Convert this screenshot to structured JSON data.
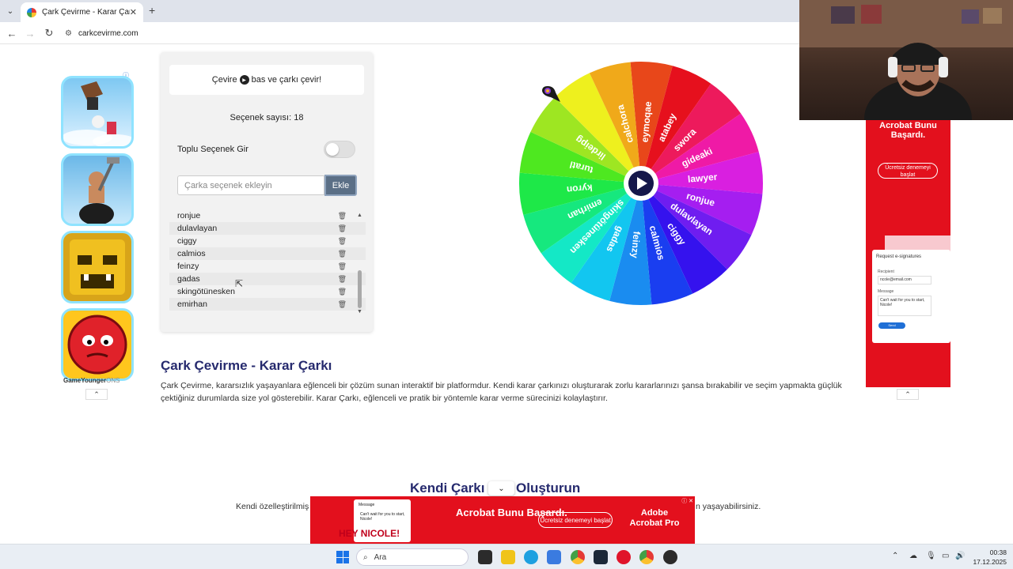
{
  "browser": {
    "tab_title": "Çark Çevirme - Karar Çarkı!",
    "tab_close": "✕",
    "new_tab": "+",
    "url": "carkcevirme.com",
    "back": "←",
    "forward": "→",
    "reload": "↻"
  },
  "left_ad": {
    "brand": "GameYounger",
    "brand_suffix": "ONS",
    "tiles": [
      "house-game",
      "hammer-climber-game",
      "temple-runner-game",
      "red-ball-game"
    ]
  },
  "panel": {
    "instruction_prefix": "Çevire",
    "instruction_suffix": "bas ve çarkı çevir!",
    "count_label": "Seçenek sayısı: 18",
    "bulk_label": "Toplu Seçenek Gir",
    "bulk_enabled": false,
    "input_placeholder": "Çarka seçenek ekleyin",
    "add_label": "Ekle",
    "options": [
      "ronjue",
      "dulavlayan",
      "ciggy",
      "calmios",
      "feinzy",
      "gadas",
      "skingötünesken",
      "emirhan"
    ],
    "delete_icon": "🗑"
  },
  "wheel": {
    "segments": [
      {
        "label": "eymoqae",
        "color": "#e8471a"
      },
      {
        "label": "atabey",
        "color": "#e6101d"
      },
      {
        "label": "swora",
        "color": "#ed1a5c"
      },
      {
        "label": "gideaki",
        "color": "#ef1aa6"
      },
      {
        "label": "lawyer",
        "color": "#d91fe0"
      },
      {
        "label": "ronjue",
        "color": "#a51ef0"
      },
      {
        "label": "dulavlayan",
        "color": "#6f1df0"
      },
      {
        "label": "ciggy",
        "color": "#3512ee"
      },
      {
        "label": "calmios",
        "color": "#1a3ef0"
      },
      {
        "label": "feinzy",
        "color": "#1a8cf0"
      },
      {
        "label": "gadas",
        "color": "#12c6f0"
      },
      {
        "label": "skingötünesken",
        "color": "#14e8c6"
      },
      {
        "label": "emirhan",
        "color": "#16e87e"
      },
      {
        "label": "kyron",
        "color": "#1ee848"
      },
      {
        "label": "turatl",
        "color": "#4ee820"
      },
      {
        "label": "lirdeipg",
        "color": "#9ee622"
      },
      {
        "label": "",
        "color": "#eef01e"
      },
      {
        "label": "calchora",
        "color": "#f0a91a"
      }
    ],
    "center_icon": "play-icon"
  },
  "article": {
    "title": "Çark Çevirme - Karar Çarkı",
    "body": "Çark Çevirme, kararsızlık yaşayanlara eğlenceli bir çözüm sunan interaktif bir platformdur. Kendi karar çarkınızı oluşturarak zorlu kararlarınızı şansa bırakabilir ve seçim yapmakta güçlük çektiğiniz durumlarda size yol gösterebilir. Karar Çarkı, eğlenceli ve pratik bir yöntemle karar verme sürecinizi kolaylaştırır.",
    "section_title_a": "Kendi Çarkı",
    "section_title_b": "Oluşturun",
    "section_body_a": "Kendi özelleştirilmiş",
    "section_body_b": "n yaşayabilirsiniz."
  },
  "right_ad": {
    "title": "Acrobat Bunu Başardı.",
    "cta": "Ücretsiz denemeyi başlat",
    "request": "Request e-signatures",
    "recipient": "Recipient",
    "email": "ncole@email.com",
    "message": "Message",
    "message_text": "Can't wait for you to start, Nicole!",
    "send": "Send"
  },
  "bottom_ad": {
    "title": "Acrobat Bunu Başardı.",
    "cta": "Ücretsiz denemeyi başlat",
    "adobe": "Adobe Acrobat Pro",
    "hey": "HEY NICOLE!",
    "card_label": "Message",
    "card_text": "Can't wait for you to start, Nicole!"
  },
  "taskbar": {
    "search": "Ara",
    "time": "00:38",
    "date": "17.12.2025"
  }
}
